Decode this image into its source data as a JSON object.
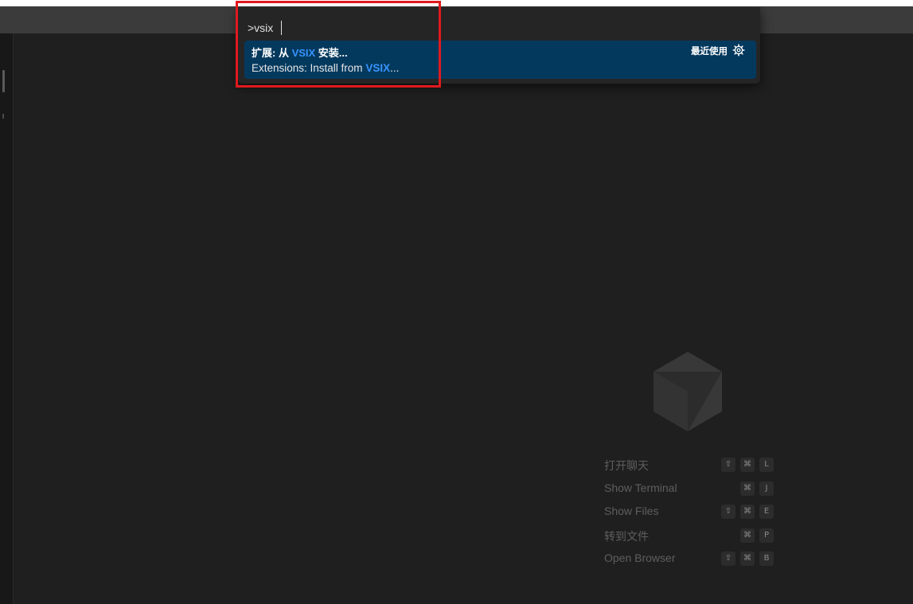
{
  "command_palette": {
    "input_value": ">vsix",
    "result": {
      "zh_prefix": "扩展: 从 ",
      "zh_highlight": "VSIX",
      "zh_suffix": " 安装...",
      "en_prefix": "Extensions: Install from ",
      "en_highlight": "VSIX",
      "en_suffix": "...",
      "recently_used": "最近使用",
      "gear_icon": "gear-icon"
    }
  },
  "shortcuts": [
    {
      "label": "打开聊天",
      "keys": [
        "⇧",
        "⌘",
        "L"
      ]
    },
    {
      "label": "Show Terminal",
      "keys": [
        "",
        "⌘",
        "J"
      ]
    },
    {
      "label": "Show Files",
      "keys": [
        "⇧",
        "⌘",
        "E"
      ]
    },
    {
      "label": "转到文件",
      "keys": [
        "",
        "⌘",
        "P"
      ]
    },
    {
      "label": "Open Browser",
      "keys": [
        "⇧",
        "⌘",
        "B"
      ]
    }
  ],
  "colors": {
    "editor_bg": "#1f1f1f",
    "selection_bg": "#04395e",
    "highlight": "#3794ff",
    "annotation_box": "#e0191e"
  }
}
